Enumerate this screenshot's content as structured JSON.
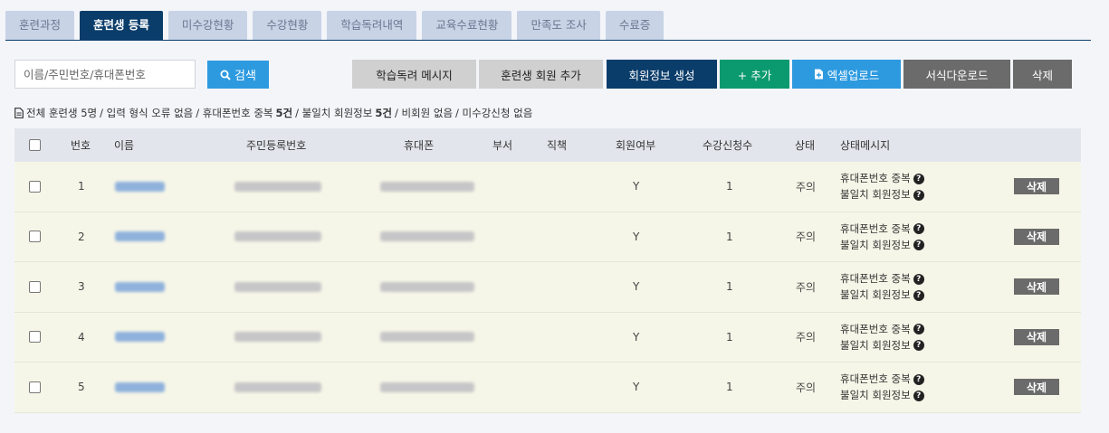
{
  "tabs": [
    "훈련과정",
    "훈련생 등록",
    "미수강현황",
    "수강현황",
    "학습독려내역",
    "교육수료현황",
    "만족도 조사",
    "수료증"
  ],
  "active_tab": 1,
  "search": {
    "placeholder": "이름/주민번호/휴대폰번호",
    "button_label": "검색"
  },
  "toolbar": {
    "encourage_msg": "학습독려 메시지",
    "add_member": "훈련생 회원 추가",
    "create_member_info": "회원정보 생성",
    "add": "+ 추가",
    "excel_upload": "엑셀업로드",
    "download_form": "서식다운로드",
    "delete": "삭제"
  },
  "summary": {
    "total": "전체 훈련생 5명",
    "format_error": "/ 입력 형식 오류 없음",
    "phone_dup_label": "/ 휴대폰번호 중복",
    "phone_dup_count": "5건",
    "mismatch_label": "/ 불일치 회원정보",
    "mismatch_count": "5건",
    "non_member": "/ 비회원 없음",
    "no_enroll": "/ 미수강신청 없음"
  },
  "table": {
    "headers": [
      "번호",
      "이름",
      "주민등록번호",
      "휴대폰",
      "부서",
      "직책",
      "회원여부",
      "수강신청수",
      "상태",
      "상태메시지"
    ],
    "rows": [
      {
        "no": "1",
        "member": "Y",
        "count": "1",
        "status": "주의",
        "msg1": "휴대폰번호 중복",
        "msg2": "불일치 회원정보",
        "delete": "삭제"
      },
      {
        "no": "2",
        "member": "Y",
        "count": "1",
        "status": "주의",
        "msg1": "휴대폰번호 중복",
        "msg2": "불일치 회원정보",
        "delete": "삭제"
      },
      {
        "no": "3",
        "member": "Y",
        "count": "1",
        "status": "주의",
        "msg1": "휴대폰번호 중복",
        "msg2": "불일치 회원정보",
        "delete": "삭제"
      },
      {
        "no": "4",
        "member": "Y",
        "count": "1",
        "status": "주의",
        "msg1": "휴대폰번호 중복",
        "msg2": "불일치 회원정보",
        "delete": "삭제"
      },
      {
        "no": "5",
        "member": "Y",
        "count": "1",
        "status": "주의",
        "msg1": "휴대폰번호 중복",
        "msg2": "불일치 회원정보",
        "delete": "삭제"
      }
    ]
  },
  "icons": {
    "search": "search-icon",
    "document": "document-icon",
    "excel": "excel-upload-icon",
    "help": "question-icon"
  },
  "colors": {
    "navy": "#0b3d6b",
    "blue": "#2d9ae0",
    "green": "#0b9a6f",
    "row_bg": "#f6f6e8"
  }
}
